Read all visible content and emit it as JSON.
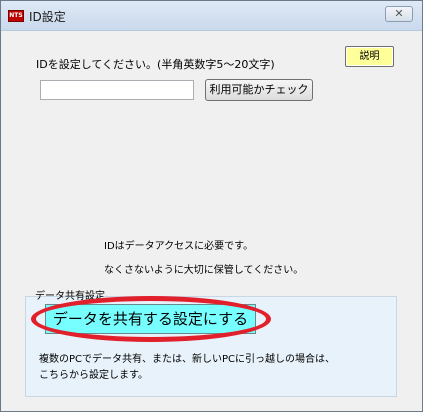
{
  "window": {
    "title": "ID設定",
    "app_icon_text": "NTS",
    "close_label": "✕"
  },
  "form": {
    "prompt": "IDを設定してください。(半角英数字5～20文字)",
    "help_label": "説明",
    "id_value": "",
    "check_label": "利用可能かチェック"
  },
  "notes": {
    "line1": "IDはデータアクセスに必要です。",
    "line2": "なくさないように大切に保管してください。"
  },
  "share": {
    "group_label": "データ共有設定",
    "button_label": "データを共有する設定にする",
    "highlight_color": "#e2202c",
    "button_color": "#77ffff",
    "desc_line1": "複数のPCでデータ共有、または、新しいPCに引っ越しの場合は、",
    "desc_line2": "こちらから設定します。"
  }
}
